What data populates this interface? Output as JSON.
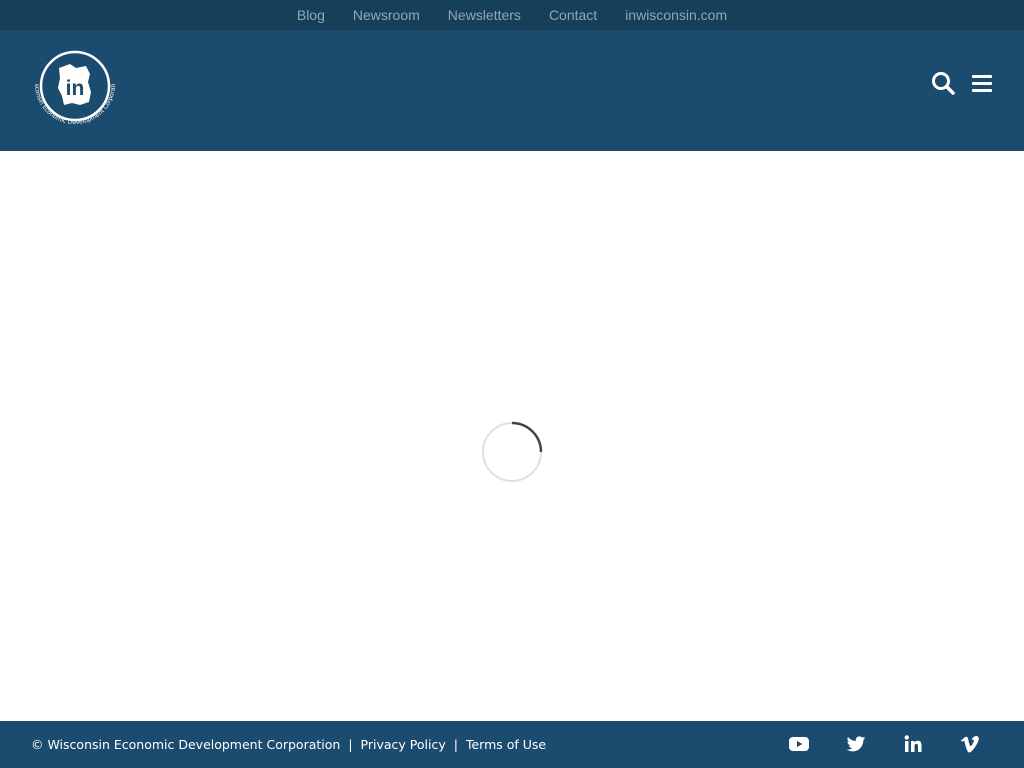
{
  "topnav": {
    "links": [
      "Blog",
      "Newsroom",
      "Newsletters",
      "Contact",
      "inwisconsin.com"
    ]
  },
  "header": {
    "logo": {
      "initials": "in",
      "arc_text": "Wisconsin Economic Development Corporation"
    },
    "icons": [
      "search-icon",
      "hamburger-menu-icon"
    ]
  },
  "main": {
    "loading_indicator": "spinner"
  },
  "footer": {
    "copyright": "© Wisconsin Economic Development Corporation",
    "separator": "|",
    "links": [
      "Privacy Policy",
      "Terms of Use"
    ],
    "social": [
      "youtube-icon",
      "twitter-icon",
      "linkedin-icon",
      "vimeo-icon"
    ]
  },
  "colors": {
    "topbar": "#16405a",
    "header": "#1b4c6f",
    "footer": "#1b4c6f",
    "topnav_text": "#8fa6b8",
    "icon": "#ffffff",
    "spinner_track": "#e0e0e0",
    "spinner_arc": "#444444"
  }
}
